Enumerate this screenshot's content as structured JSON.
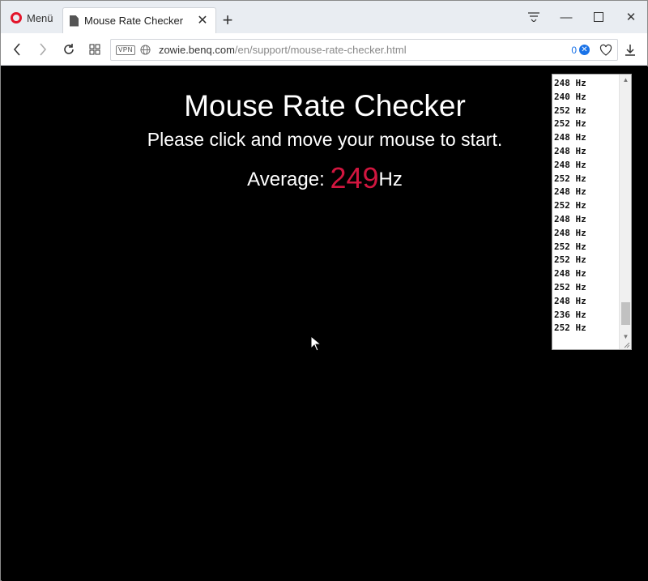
{
  "browser": {
    "menu_label": "Menü",
    "tab_title": "Mouse Rate Checker",
    "url_host": "zowie.benq.com",
    "url_path": "/en/support/mouse-rate-checker.html",
    "vpn_label": "VPN",
    "adblock_count": "0",
    "accent_color": "#e3152b"
  },
  "page": {
    "title": "Mouse Rate Checker",
    "subtitle": "Please click and move your mouse to start.",
    "average_label": "Average:",
    "average_value": "249",
    "average_unit": "Hz",
    "value_color": "#d1163f"
  },
  "log": {
    "lines": [
      "248 Hz",
      "240 Hz",
      "252 Hz",
      "252 Hz",
      "248 Hz",
      "248 Hz",
      "248 Hz",
      "252 Hz",
      "248 Hz",
      "252 Hz",
      "248 Hz",
      "248 Hz",
      "252 Hz",
      "252 Hz",
      "248 Hz",
      "252 Hz",
      "248 Hz",
      "236 Hz",
      "252 Hz"
    ]
  }
}
